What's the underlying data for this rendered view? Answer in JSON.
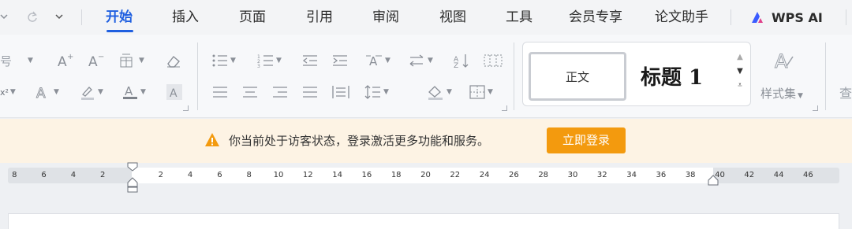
{
  "quick_access": {
    "dropdown_icon": "chevron-down-icon",
    "redo_icon": "redo-icon",
    "more_icon": "chevron-down-icon"
  },
  "tabs": [
    {
      "label": "开始",
      "active": true
    },
    {
      "label": "插入"
    },
    {
      "label": "页面"
    },
    {
      "label": "引用"
    },
    {
      "label": "审阅"
    },
    {
      "label": "视图"
    },
    {
      "label": "工具"
    },
    {
      "label": "会员专享"
    },
    {
      "label": "论文助手"
    }
  ],
  "wps_ai": {
    "label": "WPS AI",
    "accent": "#3b5bff"
  },
  "ribbon": {
    "font_size_partial": "号",
    "styles": {
      "normal": "正文",
      "heading1": "标题 1",
      "style_set_label": "样式集",
      "find_partial": "查"
    }
  },
  "notice": {
    "text": "你当前处于访客状态，登录激活更多功能和服务。",
    "login_button": "立即登录",
    "icon": "warning-icon",
    "bg_color": "#fdf3e4",
    "button_color": "#f39a0e"
  },
  "ruler": {
    "left_labels": [
      "8",
      "6",
      "4",
      "2"
    ],
    "right_labels": [
      "2",
      "4",
      "6",
      "8",
      "10",
      "12",
      "14",
      "16",
      "18",
      "20",
      "22",
      "24",
      "26",
      "28",
      "30",
      "32",
      "34",
      "36",
      "38",
      "40",
      "42",
      "44",
      "46"
    ]
  },
  "colors": {
    "accent": "#1f5fe0"
  }
}
